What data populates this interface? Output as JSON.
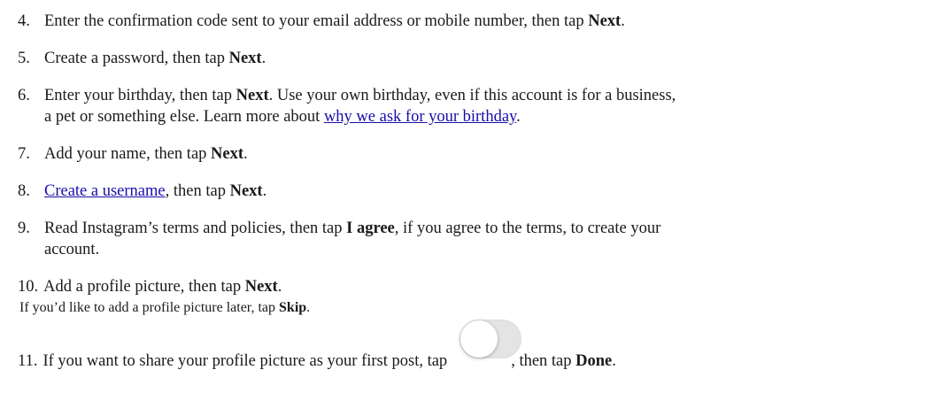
{
  "steps": [
    {
      "num": "4.",
      "before": "Enter the confirmation code sent to your email address or mobile number, then tap ",
      "bold": "Next",
      "after": "."
    },
    {
      "num": "5.",
      "before": "Create a password, then tap ",
      "bold": "Next",
      "after": "."
    },
    {
      "num": "6.",
      "before": "Enter your birthday, then tap ",
      "bold": "Next",
      "after": ". Use your own birthday, even if this account is for a business,",
      "line2_before": "a pet or something else. Learn more about ",
      "link": "why we ask for your birthday",
      "line2_after": "."
    },
    {
      "num": "7.",
      "before": "Add your name, then tap ",
      "bold": "Next",
      "after": "."
    },
    {
      "num": "8.",
      "link": "Create a username",
      "before": ", then tap ",
      "bold": "Next",
      "after": "."
    },
    {
      "num": "9.",
      "before": "Read Instagram’s terms and policies, then tap ",
      "bold": "I agree",
      "after": ", if you agree to the terms, to create your",
      "line2": "account."
    },
    {
      "num": "10.",
      "before": "Add a profile picture, then tap ",
      "bold": "Next",
      "after": ".",
      "sub_before": "If you’d like to add a profile picture later, tap ",
      "sub_bold": "Skip",
      "sub_after": "."
    },
    {
      "num": "11.",
      "before": "If you want to share your profile picture as your first post, tap",
      "after_toggle": ", then tap ",
      "bold": "Done",
      "after": "."
    }
  ],
  "toggle": {
    "state": "off",
    "icon": "toggle-switch-icon"
  }
}
